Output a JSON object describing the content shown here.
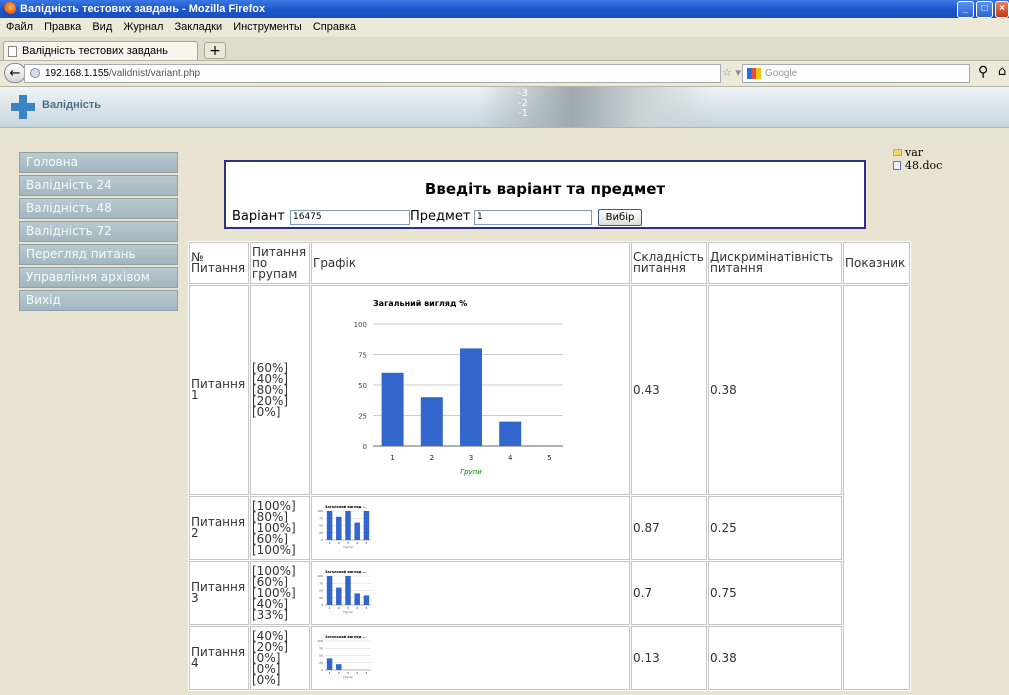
{
  "window": {
    "title": "Валідність тестових завдань - Mozilla Firefox"
  },
  "menu": [
    "Файл",
    "Правка",
    "Вид",
    "Журнал",
    "Закладки",
    "Инструменты",
    "Справка"
  ],
  "tab": {
    "label": "Валідність тестових завдань"
  },
  "address": {
    "host": "192.168.1.155",
    "path": "/validnist/variant.php"
  },
  "search": {
    "placeholder": "Google"
  },
  "site": {
    "brand": "Валідність",
    "header_marks": [
      "-3",
      "-2",
      "-1"
    ]
  },
  "sidebar": {
    "items": [
      {
        "label": "Головна"
      },
      {
        "label": "Валідність 24"
      },
      {
        "label": "Валідність 48"
      },
      {
        "label": "Валідність 72"
      },
      {
        "label": "Перегляд питань"
      },
      {
        "label": "Управління архівом"
      },
      {
        "label": "Вихід"
      }
    ]
  },
  "files": [
    {
      "name": "var",
      "icon": "folder-icon"
    },
    {
      "name": "48.doc",
      "icon": "document-icon"
    }
  ],
  "form": {
    "title": "Введіть варіант та предмет",
    "variant_label": "Варіант",
    "variant_value": "16475",
    "subject_label": "Предмет",
    "subject_value": "1",
    "submit_label": "Вибір"
  },
  "table": {
    "headers": [
      "№ Питання",
      "Питання по групам",
      "Графік",
      "Складність питання",
      "Дискримінатівність питання",
      "Показник"
    ],
    "rows": [
      {
        "question": "Питання 1",
        "groups": [
          "[60%]",
          "[40%]",
          "[80%]",
          "[20%]",
          "[0%]"
        ],
        "difficulty": "0.43",
        "discrimination": "0.38"
      },
      {
        "question": "Питання 2",
        "groups": [
          "[100%]",
          "[80%]",
          "[100%]",
          "[60%]",
          "[100%]"
        ],
        "difficulty": "0.87",
        "discrimination": "0.25"
      },
      {
        "question": "Питання 3",
        "groups": [
          "[100%]",
          "[60%]",
          "[100%]",
          "[40%]",
          "[33%]"
        ],
        "difficulty": "0.7",
        "discrimination": "0.75"
      },
      {
        "question": "Питання 4",
        "groups": [
          "[40%]",
          "[20%]",
          "[0%]",
          "[0%]",
          "[0%]"
        ],
        "difficulty": "0.13",
        "discrimination": "0.38"
      }
    ]
  },
  "chart_data": [
    {
      "type": "bar",
      "title": "Загальний вигляд %",
      "xlabel": "Групи",
      "categories": [
        "1",
        "2",
        "3",
        "4",
        "5"
      ],
      "values": [
        60,
        40,
        80,
        20,
        0
      ],
      "ylim": [
        0,
        100
      ],
      "yticks": [
        0,
        25,
        50,
        75,
        100
      ],
      "color": "#3366cc"
    },
    {
      "type": "bar",
      "title": "Загальний вигляд ...",
      "xlabel": "Групи",
      "categories": [
        "1",
        "2",
        "3",
        "4",
        "5"
      ],
      "values": [
        100,
        80,
        100,
        60,
        100
      ],
      "ylim": [
        0,
        100
      ],
      "yticks": [
        0,
        25,
        50,
        75,
        100
      ],
      "color": "#3366cc"
    },
    {
      "type": "bar",
      "title": "Загальний вигляд ...",
      "xlabel": "Групи",
      "categories": [
        "1",
        "2",
        "3",
        "4",
        "5"
      ],
      "values": [
        100,
        60,
        100,
        40,
        33
      ],
      "ylim": [
        0,
        100
      ],
      "yticks": [
        0,
        25,
        50,
        75,
        100
      ],
      "color": "#3366cc"
    },
    {
      "type": "bar",
      "title": "Загальний вигляд ...",
      "xlabel": "Групи",
      "categories": [
        "1",
        "2",
        "3",
        "4",
        "5"
      ],
      "values": [
        40,
        20,
        0,
        0,
        0
      ],
      "ylim": [
        0,
        100
      ],
      "yticks": [
        0,
        25,
        50,
        75,
        100
      ],
      "color": "#3366cc"
    }
  ]
}
